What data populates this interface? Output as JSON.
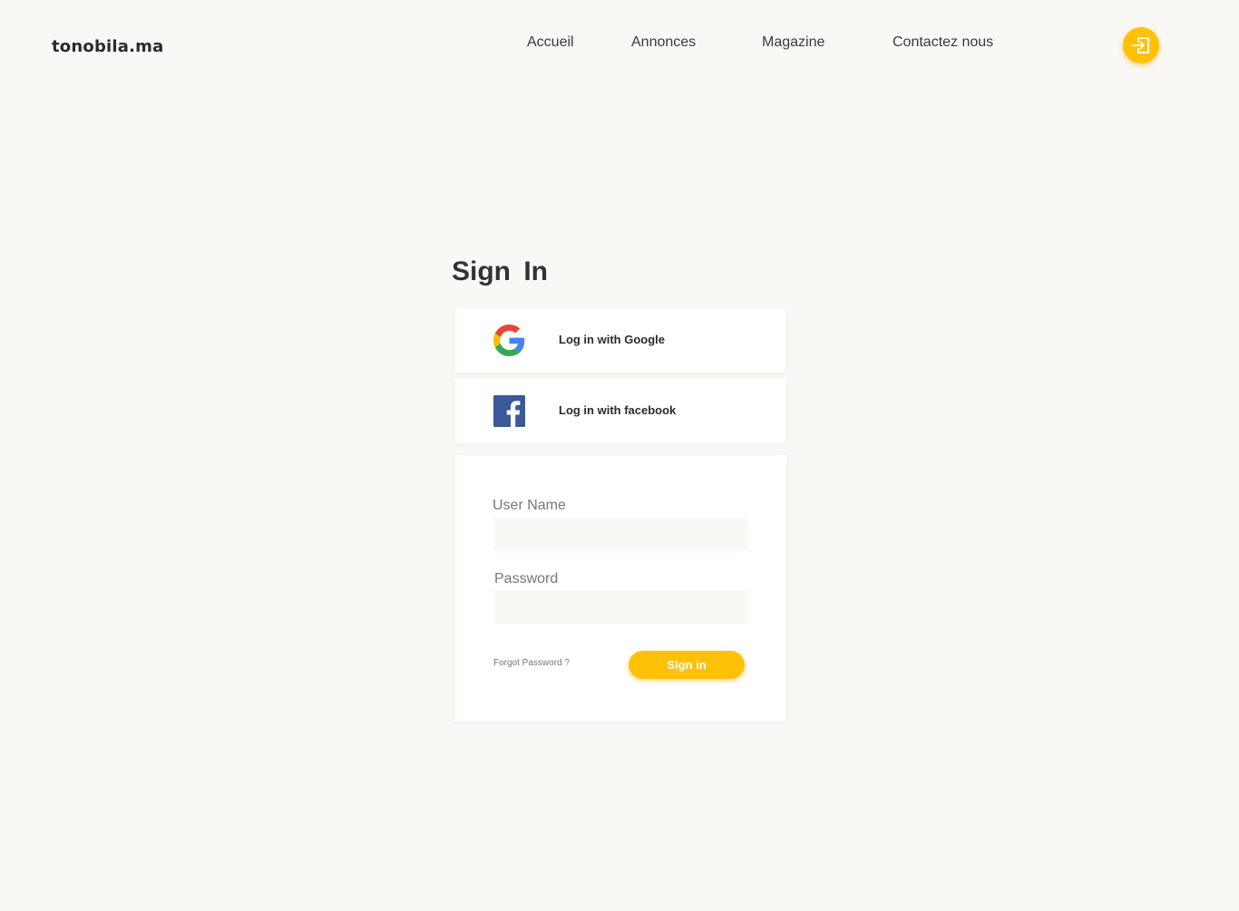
{
  "header": {
    "logo": "tonobila.ma",
    "nav": {
      "accueil": "Accueil",
      "annonces": "Annonces",
      "magazine": "Magazine",
      "contact": "Contactez nous"
    },
    "login_icon": "login-enter-icon"
  },
  "main": {
    "title": "Sign In",
    "social": {
      "google_label": "Log in with Google",
      "google_icon": "google-icon",
      "facebook_label": "Log in with facebook",
      "facebook_icon": "facebook-icon"
    },
    "form": {
      "username_label": "User Name",
      "username_value": "",
      "password_label": "Password",
      "password_value": "",
      "forgot_label": "Forgot Password ?",
      "submit_label": "Sign in"
    }
  },
  "colors": {
    "background": "#faf8f5",
    "accent": "#ffc107",
    "facebook": "#3b5998"
  }
}
